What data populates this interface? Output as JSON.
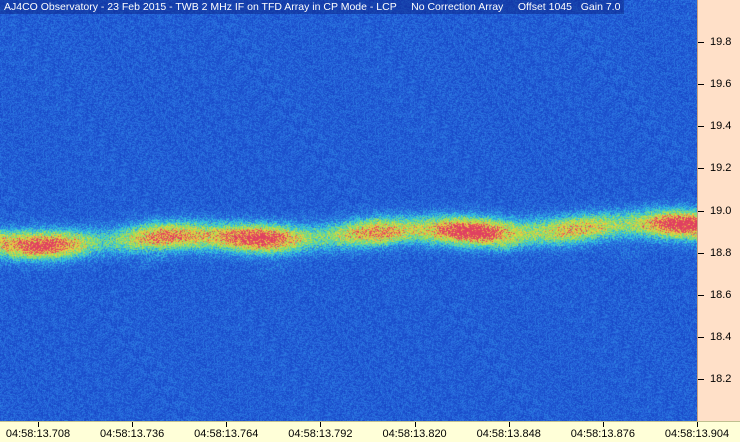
{
  "header": {
    "title": "AJ4CO Observatory - 23 Feb 2015 - TWB 2 MHz IF on TFD Array in CP Mode - LCP     No Correction Array     Offset 1045   Gain 7.0"
  },
  "colors": {
    "background_noise": "#1848c8",
    "noise_light": "#2a70e0",
    "emission_low": "#30c8e0",
    "emission_mid": "#a0e050",
    "emission_high": "#f0d040",
    "emission_peak": "#e04060",
    "freq_axis_bg": "#ffe0c8",
    "time_axis_bg": "#ffffd8"
  },
  "frequency_axis": {
    "unit": "MHz",
    "min": 18.0,
    "max": 20.0,
    "ticks": [
      "19.8",
      "19.6",
      "19.4",
      "19.2",
      "19.0",
      "18.8",
      "18.6",
      "18.4",
      "18.2"
    ]
  },
  "time_axis": {
    "ticks": [
      "04:58:13.708",
      "04:58:13.736",
      "04:58:13.764",
      "04:58:13.792",
      "04:58:13.820",
      "04:58:13.848",
      "04:58:13.876",
      "04:58:13.904"
    ]
  }
}
